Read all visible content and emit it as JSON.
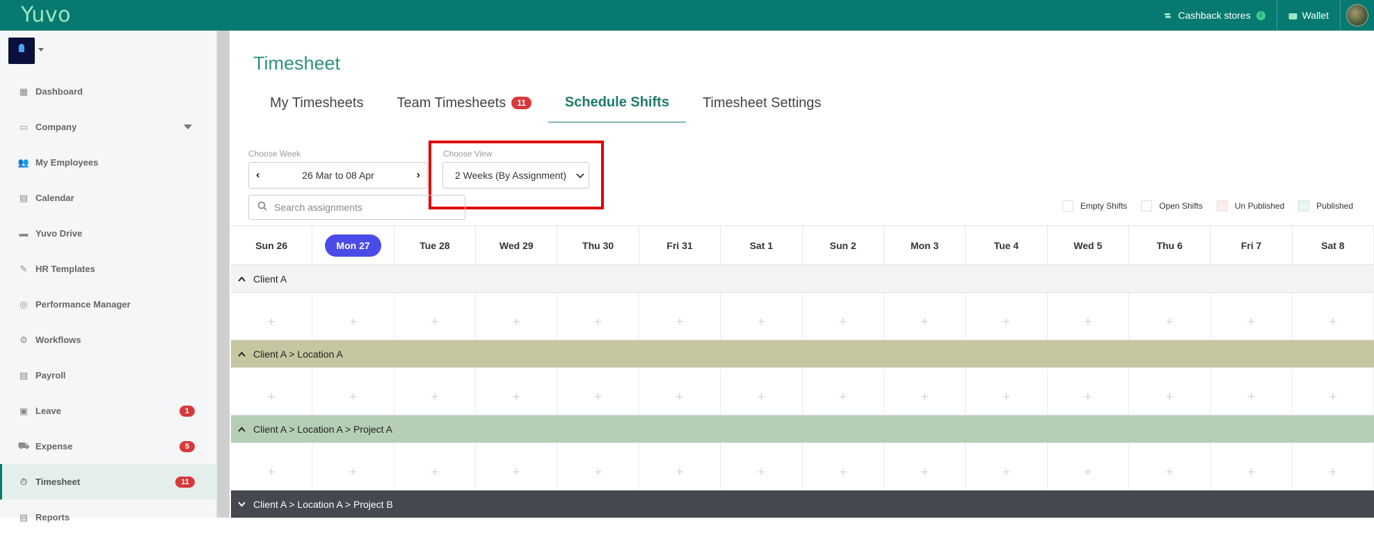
{
  "topbar": {
    "logo": "Yuvo",
    "cashback_label": "Cashback stores",
    "wallet_label": "Wallet"
  },
  "sidebar": {
    "items": [
      {
        "label": "Dashboard",
        "icon": "grid-icon"
      },
      {
        "label": "Company",
        "icon": "building-icon"
      },
      {
        "label": "My Employees",
        "icon": "users-icon"
      },
      {
        "label": "Calendar",
        "icon": "calendar-icon"
      },
      {
        "label": "Yuvo Drive",
        "icon": "folder-icon"
      },
      {
        "label": "HR Templates",
        "icon": "edit-icon"
      },
      {
        "label": "Performance Manager",
        "icon": "target-icon"
      },
      {
        "label": "Workflows",
        "icon": "cogs-icon"
      },
      {
        "label": "Payroll",
        "icon": "payroll-icon"
      },
      {
        "label": "Leave",
        "icon": "luggage-icon",
        "badge": "1"
      },
      {
        "label": "Expense",
        "icon": "expense-icon",
        "badge": "5"
      },
      {
        "label": "Timesheet",
        "icon": "stopwatch-icon",
        "badge": "11"
      },
      {
        "label": "Reports",
        "icon": "report-icon"
      }
    ]
  },
  "page": {
    "title": "Timesheet",
    "tabs": [
      {
        "label": "My Timesheets"
      },
      {
        "label": "Team Timesheets",
        "badge": "11"
      },
      {
        "label": "Schedule Shifts"
      },
      {
        "label": "Timesheet Settings"
      }
    ]
  },
  "controls": {
    "week_label": "Choose Week",
    "week_value": "26 Mar to 08 Apr",
    "view_label": "Choose View",
    "view_value": "2 Weeks (By Assignment)",
    "search_placeholder": "Search assignments"
  },
  "legend": [
    {
      "label": "Empty Shifts",
      "color": "#ffffff"
    },
    {
      "label": "Open Shifts",
      "color": "#ffffff"
    },
    {
      "label": "Un Published",
      "color": "#fdeeee"
    },
    {
      "label": "Published",
      "color": "#e8f7f1"
    }
  ],
  "days": [
    "Sun 26",
    "Mon 27",
    "Tue 28",
    "Wed 29",
    "Thu 30",
    "Fri 31",
    "Sat 1",
    "Sun 2",
    "Mon 3",
    "Tue 4",
    "Wed 5",
    "Thu 6",
    "Fri 7",
    "Sat 8"
  ],
  "today_index": 1,
  "groups": [
    {
      "label": "Client A",
      "bg": "#f2f3f4",
      "color": "#222222",
      "caret": "^"
    },
    {
      "label": "Client A > Location A",
      "bg": "#c6c6a0",
      "color": "#222222",
      "caret": "^"
    },
    {
      "label": "Client A > Location A > Project A",
      "bg": "#b5cfb5",
      "color": "#222222",
      "caret": "^"
    },
    {
      "label": "Client A > Location A > Project B",
      "bg": "#45484f",
      "color": "#ffffff",
      "caret": "v"
    }
  ]
}
